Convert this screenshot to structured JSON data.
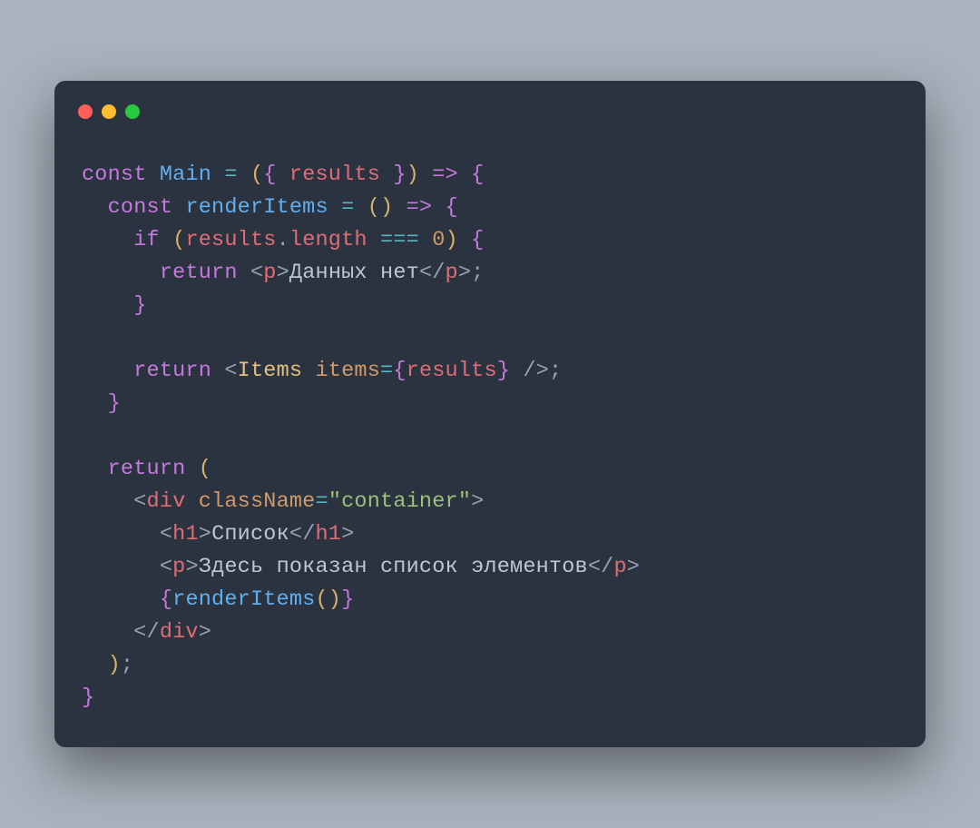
{
  "traffic_lights": {
    "red": "#ff5f57",
    "yellow": "#febc2e",
    "green": "#28c840"
  },
  "code": {
    "kw_const1": "const",
    "fn_Main": "Main",
    "eq1": " = ",
    "p_o1": "(",
    "b_o1": "{ ",
    "arg_results": "results",
    "b_c1": " }",
    "p_c1": ")",
    "arrow1": " => ",
    "b_o2": "{",
    "indent2": "  ",
    "kw_const2": "const",
    "fn_renderItems": "renderItems",
    "eq2": " = ",
    "p_o2": "(",
    "p_c2": ")",
    "arrow2": " => ",
    "b_o3": "{",
    "indent4": "    ",
    "kw_if": "if",
    "sp": " ",
    "p_o3": "(",
    "var_results": "results",
    "dot": ".",
    "member_length": "length",
    "op_eq3": " === ",
    "num_0": "0",
    "p_c3": ")",
    "b_o4": " {",
    "indent6": "      ",
    "kw_return1": "return",
    "lt": "<",
    "gt": ">",
    "ltc": "</",
    "slashgt": " />",
    "tag_p": "p",
    "txt_nodata": "Данных нет",
    "semi": ";",
    "b_c4": "}",
    "kw_return2": "return",
    "comp_Items": "Items",
    "attr_items": "items",
    "eqattr": "=",
    "jb_o": "{",
    "jb_c": "}",
    "b_c3": "}",
    "kw_return3": "return",
    "p_o4": " (",
    "tag_div": "div",
    "attr_className": "className",
    "str_container": "\"container\"",
    "tag_h1": "h1",
    "txt_heading": "Список",
    "txt_desc": "Здесь показан список элементов",
    "call_renderItems": "renderItems",
    "p_call_o": "(",
    "p_call_c": ")",
    "p_c4": ")",
    "b_c2": "}"
  }
}
